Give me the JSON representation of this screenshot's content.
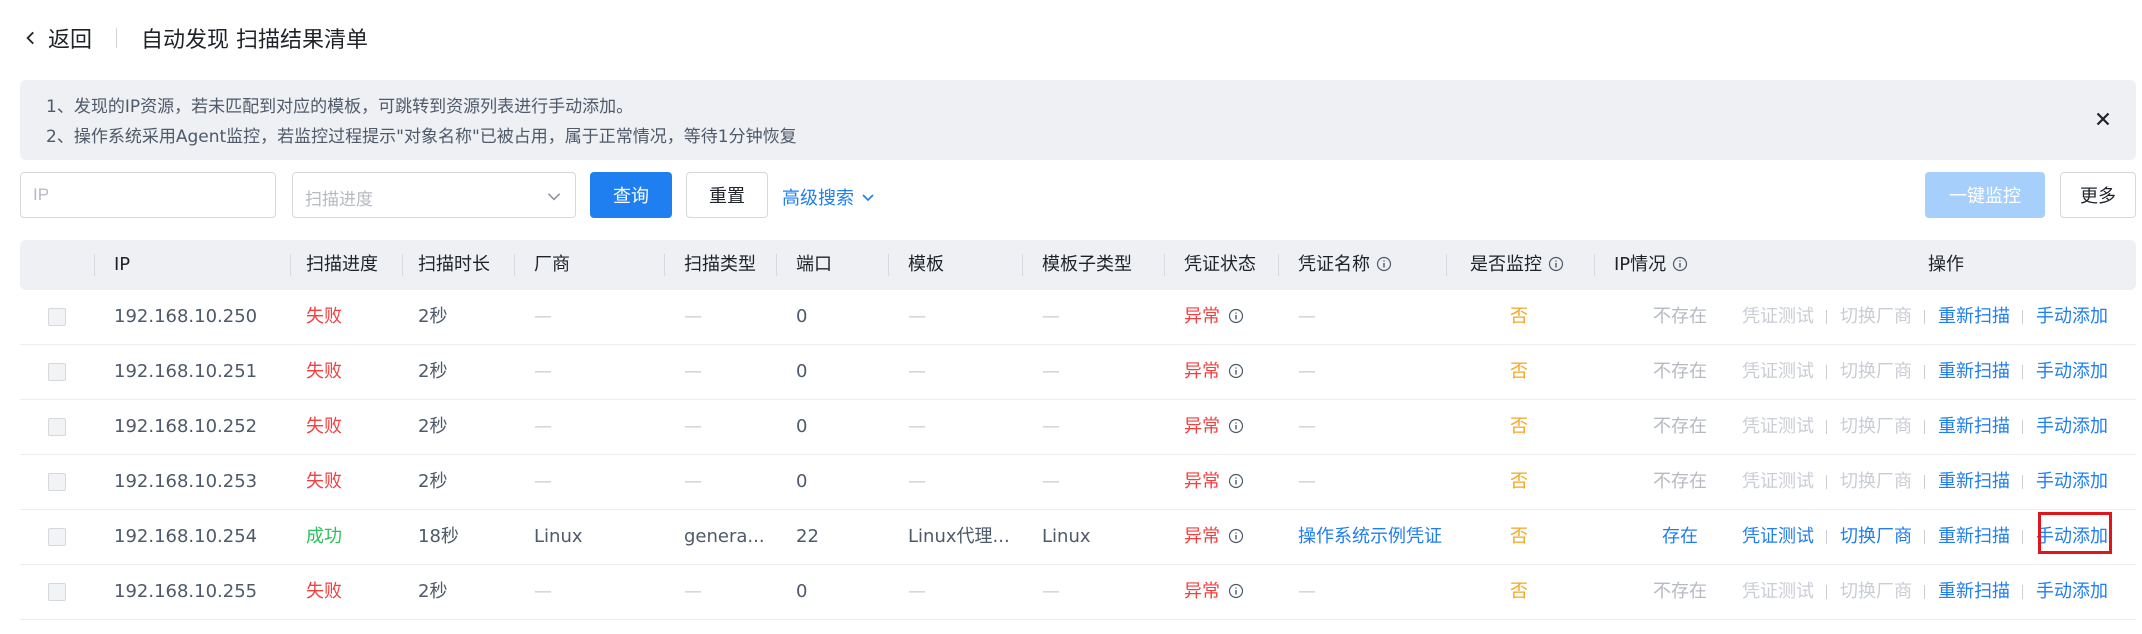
{
  "header": {
    "back_label": "返回",
    "title": "自动发现 扫描结果清单"
  },
  "notice": {
    "line1": "1、发现的IP资源，若未匹配到对应的模板，可跳转到资源列表进行手动添加。",
    "line2": "2、操作系统采用Agent监控，若监控过程提示\"对象名称\"已被占用，属于正常情况，等待1分钟恢复"
  },
  "toolbar": {
    "ip_placeholder": "IP",
    "progress_placeholder": "扫描进度",
    "query_label": "查询",
    "reset_label": "重置",
    "advanced_label": "高级搜索",
    "one_click_monitor_label": "一键监控",
    "more_label": "更多"
  },
  "table": {
    "headers": {
      "ip": "IP",
      "progress": "扫描进度",
      "duration": "扫描时长",
      "vendor": "厂商",
      "scan_type": "扫描类型",
      "port": "端口",
      "template": "模板",
      "template_subtype": "模板子类型",
      "cred_status": "凭证状态",
      "cred_name": "凭证名称",
      "monitored": "是否监控",
      "ip_status": "IP情况",
      "actions": "操作"
    },
    "dash": "—",
    "rows": [
      {
        "ip": "192.168.10.250",
        "progress": "失败",
        "duration": "2秒",
        "vendor": "—",
        "scan_type": "—",
        "port": "0",
        "template": "—",
        "subtype": "—",
        "cred_status": "异常",
        "cred_name": "—",
        "monitored": "否",
        "ip_status": "不存在"
      },
      {
        "ip": "192.168.10.251",
        "progress": "失败",
        "duration": "2秒",
        "vendor": "—",
        "scan_type": "—",
        "port": "0",
        "template": "—",
        "subtype": "—",
        "cred_status": "异常",
        "cred_name": "—",
        "monitored": "否",
        "ip_status": "不存在"
      },
      {
        "ip": "192.168.10.252",
        "progress": "失败",
        "duration": "2秒",
        "vendor": "—",
        "scan_type": "—",
        "port": "0",
        "template": "—",
        "subtype": "—",
        "cred_status": "异常",
        "cred_name": "—",
        "monitored": "否",
        "ip_status": "不存在"
      },
      {
        "ip": "192.168.10.253",
        "progress": "失败",
        "duration": "2秒",
        "vendor": "—",
        "scan_type": "—",
        "port": "0",
        "template": "—",
        "subtype": "—",
        "cred_status": "异常",
        "cred_name": "—",
        "monitored": "否",
        "ip_status": "不存在"
      },
      {
        "ip": "192.168.10.254",
        "progress": "成功",
        "duration": "18秒",
        "vendor": "Linux",
        "scan_type": "genera...",
        "port": "22",
        "template": "Linux代理...",
        "subtype": "Linux",
        "cred_status": "异常",
        "cred_name": "操作系统示例凭证",
        "monitored": "否",
        "ip_status": "存在"
      },
      {
        "ip": "192.168.10.255",
        "progress": "失败",
        "duration": "2秒",
        "vendor": "—",
        "scan_type": "—",
        "port": "0",
        "template": "—",
        "subtype": "—",
        "cred_status": "异常",
        "cred_name": "—",
        "monitored": "否",
        "ip_status": "不存在"
      }
    ],
    "actions": {
      "test": "凭证测试",
      "switch_vendor": "切换厂商",
      "rescan": "重新扫描",
      "manual_add": "手动添加"
    }
  },
  "colors": {
    "primary": "#1f7ef0",
    "danger": "#f53f3f",
    "success": "#2bc15e",
    "warning": "#f5a623",
    "highlight_box": "#e0161d"
  }
}
